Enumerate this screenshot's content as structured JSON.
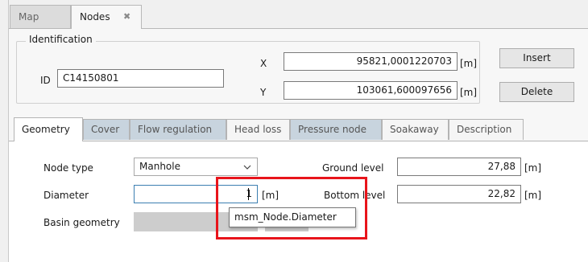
{
  "doc_tabs": [
    {
      "label": "Map",
      "active": false
    },
    {
      "label": "Nodes",
      "active": true
    }
  ],
  "close_glyph": "✖",
  "identification": {
    "legend": "Identification",
    "id_label": "ID",
    "id_value": "C14150801",
    "x_label": "X",
    "x_value": "95821,0001220703",
    "x_unit": "[m]",
    "y_label": "Y",
    "y_value": "103061,600097656",
    "y_unit": "[m]",
    "insert_label": "Insert",
    "delete_label": "Delete"
  },
  "property_tabs": [
    {
      "label": "Geometry",
      "active": true
    },
    {
      "label": "Cover"
    },
    {
      "label": "Flow regulation"
    },
    {
      "label": "Head loss"
    },
    {
      "label": "Pressure node"
    },
    {
      "label": "Soakaway"
    },
    {
      "label": "Description"
    }
  ],
  "geometry": {
    "node_type_label": "Node type",
    "node_type_value": "Manhole",
    "diameter_label": "Diameter",
    "diameter_value": "1",
    "diameter_unit": "[m]",
    "basin_label": "Basin geometry",
    "ground_label": "Ground level",
    "ground_value": "27,88",
    "ground_unit": "[m]",
    "bottom_label": "Bottom level",
    "bottom_value": "22,82",
    "bottom_unit": "[m]",
    "tooltip": "msm_Node.Diameter"
  },
  "highlight_color": "#e8141b"
}
